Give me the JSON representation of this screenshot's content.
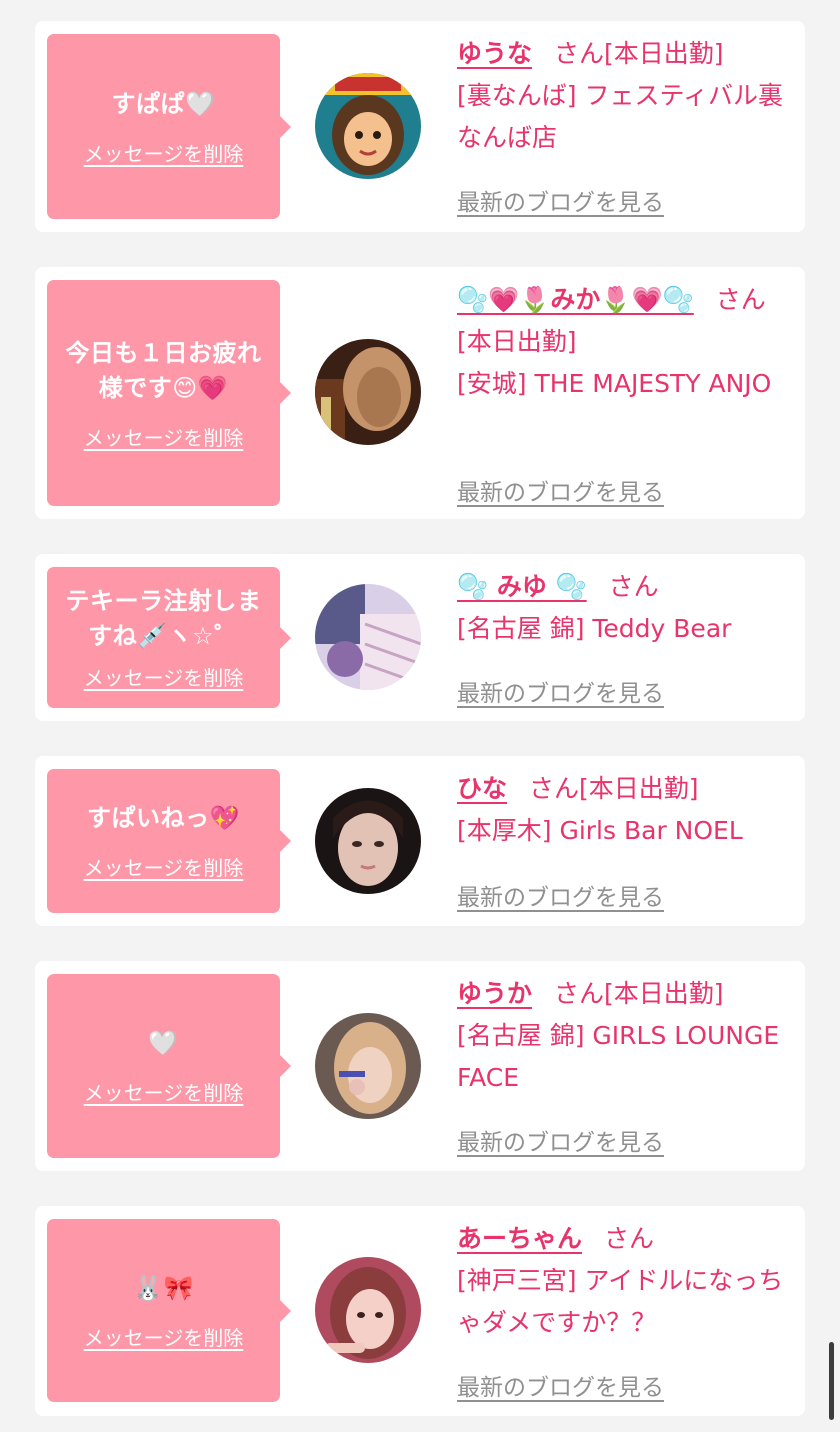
{
  "common": {
    "delete_label": "メッセージを削除",
    "blog_label": "最新のブログを見る",
    "san_label": "さん"
  },
  "colors": {
    "bubble": "#fe97a8",
    "accent": "#e8336b",
    "link_gray": "#909090",
    "background": "#f3f3f3"
  },
  "cards": [
    {
      "message": "すぱぱ🤍",
      "name": "ゆうな",
      "san_suffix": "さん[本日出勤]",
      "shop": "[裏なんば] フェスティバル裏なんば店",
      "avatar_icon": "avatar-cartoon-girl-icon"
    },
    {
      "message": "今日も１日お疲れ様です😊💗",
      "name": "🫧💗🌷みか🌷💗🫧",
      "san_suffix": "さん[本日出勤]",
      "shop": "[安城] THE MAJESTY ANJO",
      "avatar_icon": "avatar-photo-icon"
    },
    {
      "message": "テキーラ注射しますね💉ヽ☆゜",
      "name": "🫧 みゆ 🫧",
      "san_suffix": "さん",
      "shop": "[名古屋 錦] Teddy Bear",
      "avatar_icon": "avatar-photo-icon"
    },
    {
      "message": "すぱいねっ💖",
      "name": "ひな",
      "san_suffix": "さん[本日出勤]",
      "shop": "[本厚木] Girls Bar NOEL",
      "avatar_icon": "avatar-photo-icon"
    },
    {
      "message": "🤍",
      "name": "ゆうか",
      "san_suffix": "さん[本日出勤]",
      "shop": "[名古屋 錦] GIRLS LOUNGE FACE",
      "avatar_icon": "avatar-photo-icon"
    },
    {
      "message": "🐰🎀",
      "name": "あーちゃん",
      "san_suffix": "さん",
      "shop": "[神戸三宮] アイドルになっちゃダメですか？？",
      "avatar_icon": "avatar-photo-icon"
    }
  ]
}
